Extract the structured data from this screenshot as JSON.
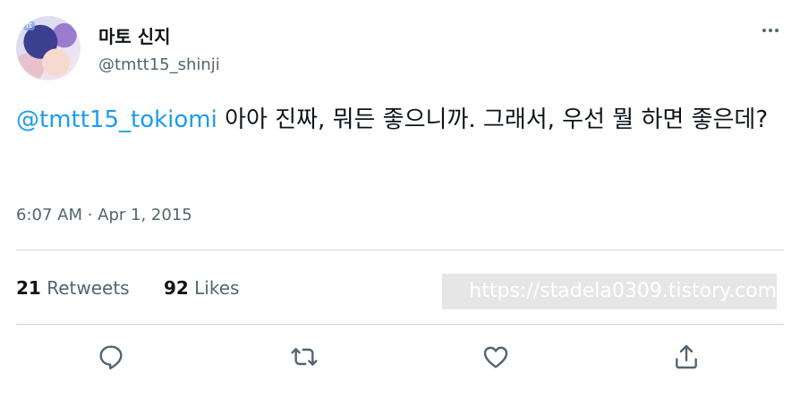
{
  "author": {
    "display_name": "마토 신지",
    "handle": "@tmtt15_shinji",
    "avatar_tag": "tt"
  },
  "tweet": {
    "mention": "@tmtt15_tokiomi",
    "text": " 아아 진짜, 뭐든 좋으니까. 그래서, 우선 뭘 하면 좋은데?",
    "timestamp": "6:07 AM · Apr 1, 2015"
  },
  "stats": {
    "retweets_count": "21",
    "retweets_label": "Retweets",
    "likes_count": "92",
    "likes_label": "Likes"
  },
  "watermark": "https://stadela0309.tistory.com",
  "icons": {
    "more": "more-icon",
    "reply": "reply-icon",
    "retweet": "retweet-icon",
    "like": "heart-icon",
    "share": "share-icon"
  },
  "colors": {
    "link": "#1d9bf0",
    "text": "#0f1419",
    "secondary": "#536471",
    "divider": "#cfd9de"
  }
}
